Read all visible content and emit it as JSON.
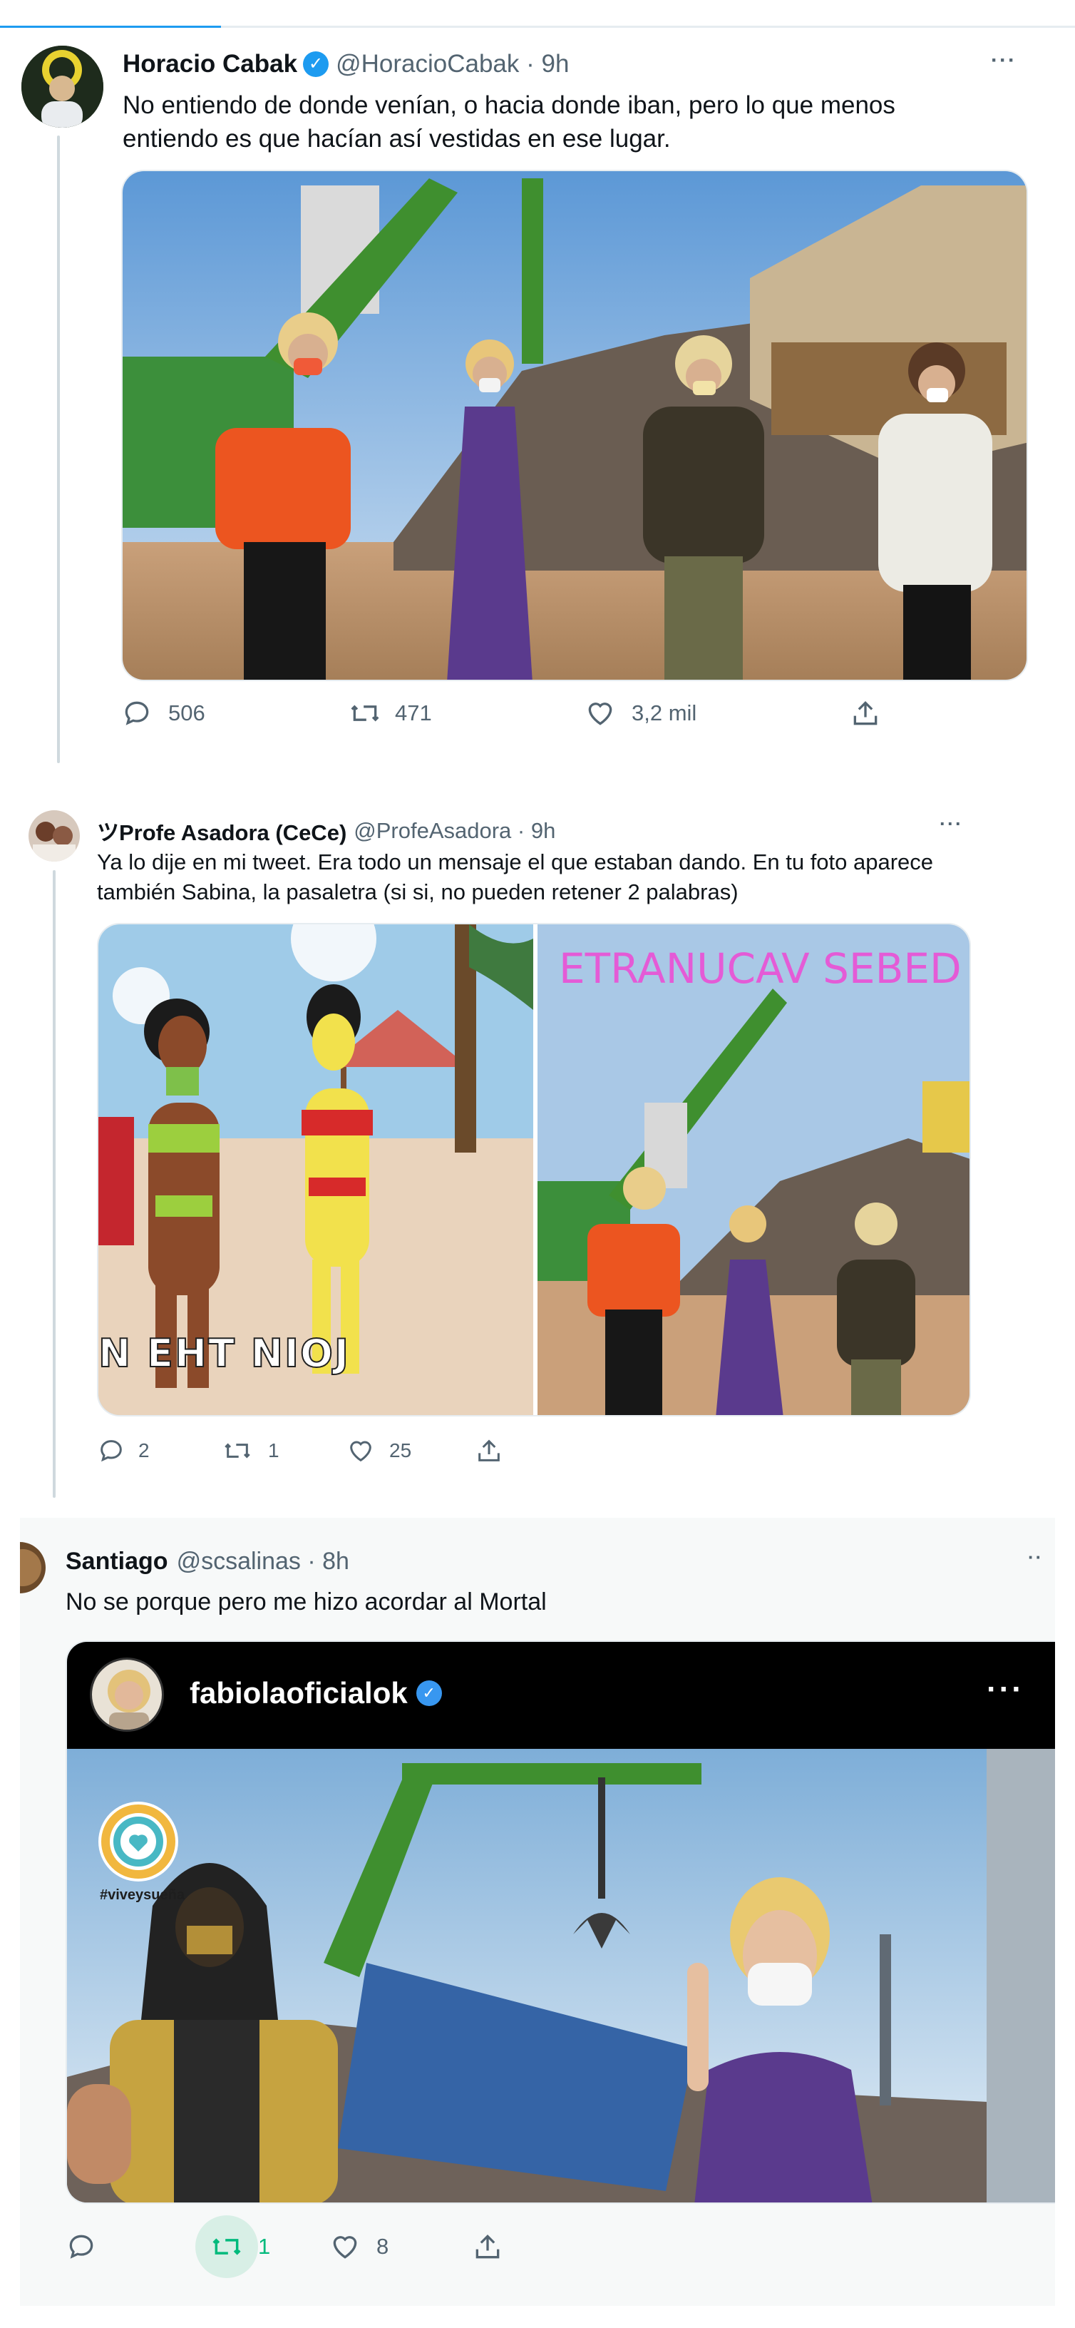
{
  "tweets": [
    {
      "name": "Horacio Cabak",
      "handle": "@HoracioCabak · 9h",
      "text": "No entiendo de donde venían, o hacia donde iban, pero lo que menos entiendo es que hacían así vestidas en ese lugar.",
      "replies": "506",
      "retweets": "471",
      "likes": "3,2 mil"
    },
    {
      "name": "ツProfe Asadora (CeCe)",
      "handle": "@ProfeAsadora · 9h",
      "text": "Ya lo dije en mi tweet. Era todo un mensaje el que estaban dando. En tu foto aparece también Sabina, la pasaletra (si si, no pueden retener 2 palabras)",
      "left_caption": "N EHT NIOJ",
      "right_caption": "ETRANUCAV SEBED",
      "replies": "2",
      "retweets": "1",
      "likes": "25"
    },
    {
      "name": "Santiago",
      "handle": "@scsalinas · 8h",
      "text": "No se porque pero me hizo acordar al Mortal",
      "embed_user": "fabiolaoficialok",
      "embed_tag": "#viveysueña",
      "replies": "",
      "retweets": "1",
      "likes": "8"
    }
  ],
  "colors": {
    "accent": "#1d9bf0",
    "retweet_active": "#00ba7c",
    "text_secondary": "#536471"
  },
  "icons": [
    "reply-icon",
    "retweet-icon",
    "like-icon",
    "share-icon",
    "more-icon",
    "verified-icon"
  ]
}
